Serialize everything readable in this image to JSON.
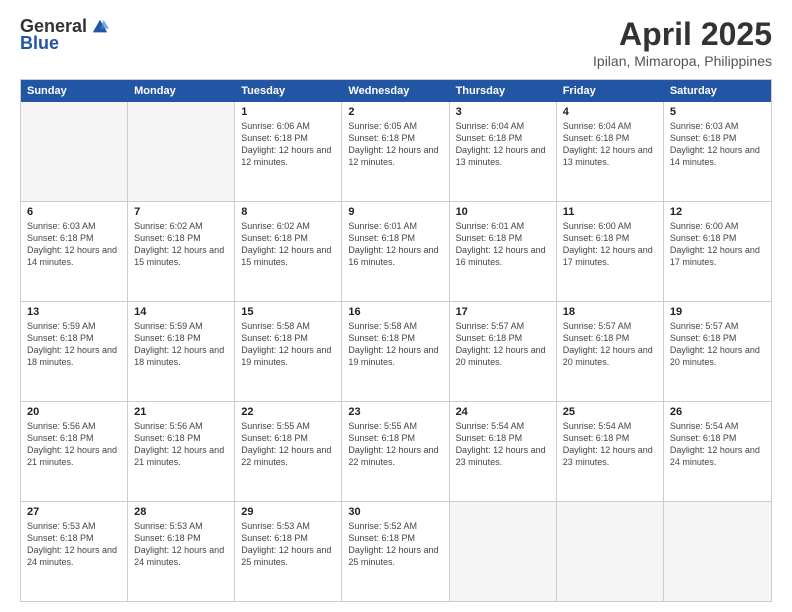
{
  "header": {
    "logo_general": "General",
    "logo_blue": "Blue",
    "month_title": "April 2025",
    "location": "Ipilan, Mimaropa, Philippines"
  },
  "calendar": {
    "days_of_week": [
      "Sunday",
      "Monday",
      "Tuesday",
      "Wednesday",
      "Thursday",
      "Friday",
      "Saturday"
    ],
    "weeks": [
      [
        {
          "day": "",
          "empty": true
        },
        {
          "day": "",
          "empty": true
        },
        {
          "day": "1",
          "sunrise": "6:06 AM",
          "sunset": "6:18 PM",
          "daylight": "12 hours and 12 minutes."
        },
        {
          "day": "2",
          "sunrise": "6:05 AM",
          "sunset": "6:18 PM",
          "daylight": "12 hours and 12 minutes."
        },
        {
          "day": "3",
          "sunrise": "6:04 AM",
          "sunset": "6:18 PM",
          "daylight": "12 hours and 13 minutes."
        },
        {
          "day": "4",
          "sunrise": "6:04 AM",
          "sunset": "6:18 PM",
          "daylight": "12 hours and 13 minutes."
        },
        {
          "day": "5",
          "sunrise": "6:03 AM",
          "sunset": "6:18 PM",
          "daylight": "12 hours and 14 minutes."
        }
      ],
      [
        {
          "day": "6",
          "sunrise": "6:03 AM",
          "sunset": "6:18 PM",
          "daylight": "12 hours and 14 minutes."
        },
        {
          "day": "7",
          "sunrise": "6:02 AM",
          "sunset": "6:18 PM",
          "daylight": "12 hours and 15 minutes."
        },
        {
          "day": "8",
          "sunrise": "6:02 AM",
          "sunset": "6:18 PM",
          "daylight": "12 hours and 15 minutes."
        },
        {
          "day": "9",
          "sunrise": "6:01 AM",
          "sunset": "6:18 PM",
          "daylight": "12 hours and 16 minutes."
        },
        {
          "day": "10",
          "sunrise": "6:01 AM",
          "sunset": "6:18 PM",
          "daylight": "12 hours and 16 minutes."
        },
        {
          "day": "11",
          "sunrise": "6:00 AM",
          "sunset": "6:18 PM",
          "daylight": "12 hours and 17 minutes."
        },
        {
          "day": "12",
          "sunrise": "6:00 AM",
          "sunset": "6:18 PM",
          "daylight": "12 hours and 17 minutes."
        }
      ],
      [
        {
          "day": "13",
          "sunrise": "5:59 AM",
          "sunset": "6:18 PM",
          "daylight": "12 hours and 18 minutes."
        },
        {
          "day": "14",
          "sunrise": "5:59 AM",
          "sunset": "6:18 PM",
          "daylight": "12 hours and 18 minutes."
        },
        {
          "day": "15",
          "sunrise": "5:58 AM",
          "sunset": "6:18 PM",
          "daylight": "12 hours and 19 minutes."
        },
        {
          "day": "16",
          "sunrise": "5:58 AM",
          "sunset": "6:18 PM",
          "daylight": "12 hours and 19 minutes."
        },
        {
          "day": "17",
          "sunrise": "5:57 AM",
          "sunset": "6:18 PM",
          "daylight": "12 hours and 20 minutes."
        },
        {
          "day": "18",
          "sunrise": "5:57 AM",
          "sunset": "6:18 PM",
          "daylight": "12 hours and 20 minutes."
        },
        {
          "day": "19",
          "sunrise": "5:57 AM",
          "sunset": "6:18 PM",
          "daylight": "12 hours and 20 minutes."
        }
      ],
      [
        {
          "day": "20",
          "sunrise": "5:56 AM",
          "sunset": "6:18 PM",
          "daylight": "12 hours and 21 minutes."
        },
        {
          "day": "21",
          "sunrise": "5:56 AM",
          "sunset": "6:18 PM",
          "daylight": "12 hours and 21 minutes."
        },
        {
          "day": "22",
          "sunrise": "5:55 AM",
          "sunset": "6:18 PM",
          "daylight": "12 hours and 22 minutes."
        },
        {
          "day": "23",
          "sunrise": "5:55 AM",
          "sunset": "6:18 PM",
          "daylight": "12 hours and 22 minutes."
        },
        {
          "day": "24",
          "sunrise": "5:54 AM",
          "sunset": "6:18 PM",
          "daylight": "12 hours and 23 minutes."
        },
        {
          "day": "25",
          "sunrise": "5:54 AM",
          "sunset": "6:18 PM",
          "daylight": "12 hours and 23 minutes."
        },
        {
          "day": "26",
          "sunrise": "5:54 AM",
          "sunset": "6:18 PM",
          "daylight": "12 hours and 24 minutes."
        }
      ],
      [
        {
          "day": "27",
          "sunrise": "5:53 AM",
          "sunset": "6:18 PM",
          "daylight": "12 hours and 24 minutes."
        },
        {
          "day": "28",
          "sunrise": "5:53 AM",
          "sunset": "6:18 PM",
          "daylight": "12 hours and 24 minutes."
        },
        {
          "day": "29",
          "sunrise": "5:53 AM",
          "sunset": "6:18 PM",
          "daylight": "12 hours and 25 minutes."
        },
        {
          "day": "30",
          "sunrise": "5:52 AM",
          "sunset": "6:18 PM",
          "daylight": "12 hours and 25 minutes."
        },
        {
          "day": "",
          "empty": true
        },
        {
          "day": "",
          "empty": true
        },
        {
          "day": "",
          "empty": true
        }
      ]
    ]
  }
}
